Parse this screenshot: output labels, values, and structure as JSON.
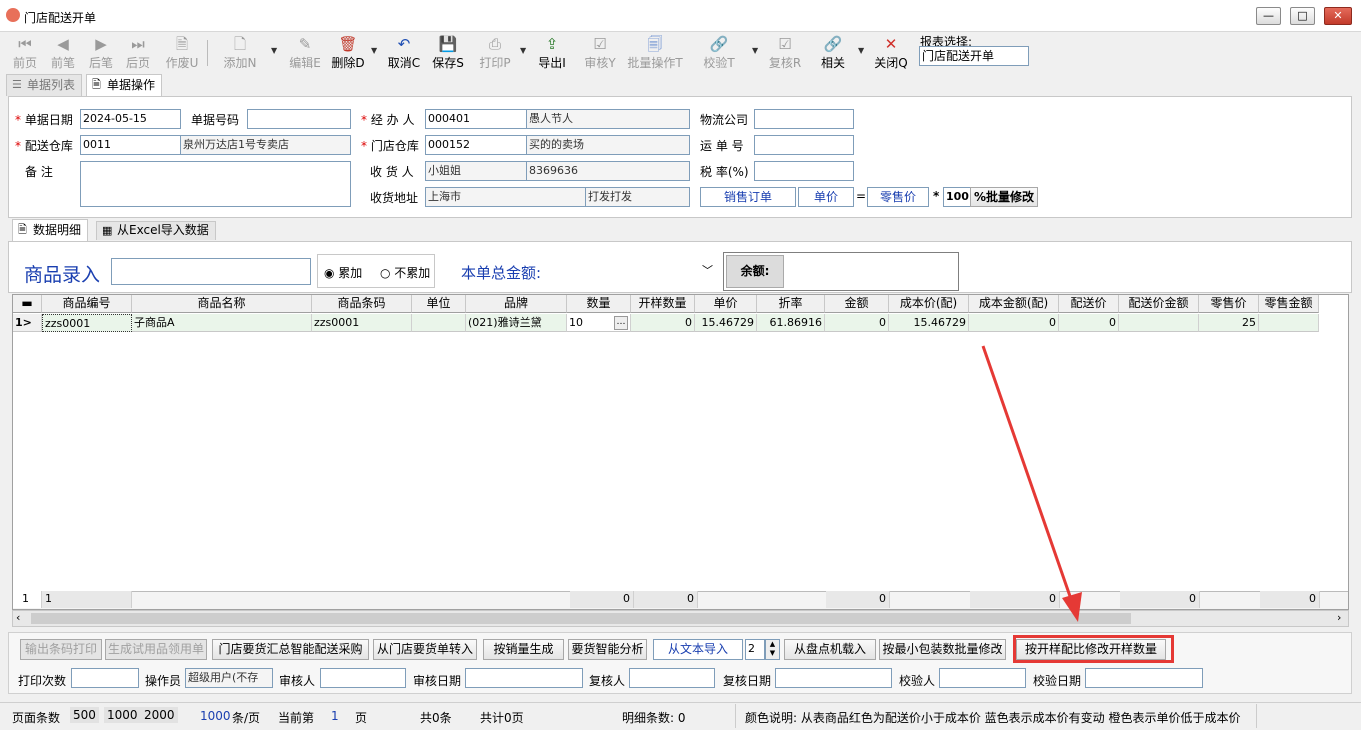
{
  "window": {
    "title": "门店配送开单",
    "btn_min": "—",
    "btn_max": "□",
    "btn_close": "✕"
  },
  "toolbar": {
    "first": "前页",
    "prev": "前笔",
    "next": "后笔",
    "last": "后页",
    "void": "作废U",
    "add": "添加N",
    "edit": "编辑E",
    "delete": "删除D",
    "cancel": "取消C",
    "save": "保存S",
    "print": "打印P",
    "export": "导出I",
    "audit": "审核Y",
    "batch": "批量操作T",
    "verify": "校验T",
    "recheck": "复核R",
    "related": "相关",
    "close": "关闭Q",
    "report_label": "报表选择:",
    "report_value": "门店配送开单"
  },
  "tabs": {
    "list": "单据列表",
    "op": "单据操作"
  },
  "form": {
    "date_label": "单据日期",
    "date": "2024-05-15",
    "no_label": "单据号码",
    "no": "",
    "handler_label": "经 办 人",
    "handler_code": "000401",
    "handler_name": "愚人节人",
    "logistics_label": "物流公司",
    "logistics": "",
    "wh_label": "配送仓库",
    "wh_code": "0011",
    "wh_name": "泉州万达店1号专卖店",
    "store_label": "门店仓库",
    "store_code": "000152",
    "store_name": "买的的卖场",
    "waybill_label": "运 单 号",
    "waybill": "",
    "note_label": "备    注",
    "note": "",
    "receiver_label": "收 货 人",
    "receiver": "小姐姐",
    "receiver_phone": "8369636",
    "tax_label": "税 率(%)",
    "tax": "",
    "addr_label": "收货地址",
    "addr1": "上海市",
    "addr2": "打发打发",
    "sales_order_btn": "销售订单",
    "unit_price_btn": "单价",
    "eq": "=",
    "retail_btn": "零售价",
    "mult": "*",
    "pct": "100",
    "batch_btn": "%批量修改"
  },
  "detail_tabs": {
    "data": "数据明细",
    "excel": "从Excel导入数据"
  },
  "entry": {
    "label": "商品录入",
    "input": "",
    "radio_acc": "累加",
    "radio_noacc": "不累加",
    "total_label": "本单总金额:",
    "total_value": "",
    "balance_label": "余额:",
    "balance": ""
  },
  "grid": {
    "columns": [
      "商品编号",
      "商品名称",
      "商品条码",
      "单位",
      "品牌",
      "数量",
      "开样数量",
      "单价",
      "折率",
      "金额",
      "成本价(配)",
      "成本金额(配)",
      "配送价",
      "配送价金额",
      "零售价",
      "零售金额"
    ],
    "rows": [
      {
        "idx": "1>",
        "cells": [
          "zzs0001",
          "子商品A",
          "zzs0001",
          "",
          "(021)雅诗兰黛",
          "10",
          "0",
          "15.46729",
          "61.86916",
          "0",
          "15.46729",
          "0",
          "0",
          "",
          "25",
          ""
        ]
      }
    ],
    "footer": {
      "index": "1",
      "count": "1",
      "qty": "0",
      "sample": "0",
      "amount": "0",
      "cost_amount": "0",
      "dist_amount": "0",
      "retail_amount": "0"
    }
  },
  "bottom_buttons": {
    "barcode_print": "输出条码打印",
    "trial_receipt": "生成试用品领用单",
    "store_summary": "门店要货汇总智能配送采购",
    "from_store_order": "从门店要货单转入",
    "by_sales": "按销量生成",
    "smart_analysis": "要货智能分析",
    "from_text": "从文本导入",
    "spin": "2",
    "from_inventory": "从盘点机载入",
    "min_pack": "按最小包装数批量修改",
    "sample_ratio": "按开样配比修改开样数量"
  },
  "audit": {
    "print_count": "打印次数",
    "print_count_val": "",
    "operator": "操作员",
    "operator_val": "超级用户(不存",
    "auditor": "审核人",
    "audit_date": "审核日期",
    "rechecker": "复核人",
    "recheck_date": "复核日期",
    "verifier": "校验人",
    "verify_date": "校验日期"
  },
  "status": {
    "page_rows_label": "页面条数",
    "s500": "500",
    "s1000": "1000",
    "s2000": "2000",
    "per_page": "1000",
    "per_page_unit": "条/页",
    "current_label": "当前第",
    "current": "1",
    "page_unit": "页",
    "total_rows": "共0条",
    "total_pages": "共计0页",
    "detail_count": "明细条数: 0",
    "color_note": "颜色说明: 从表商品红色为配送价小于成本价 蓝色表示成本价有变动 橙色表示单价低于成本价"
  },
  "colors": {
    "accent_blue": "#1a3fb0",
    "required_red": "#dd0000",
    "highlight_red": "#e53935",
    "grid_row": "#eaf5ea"
  }
}
